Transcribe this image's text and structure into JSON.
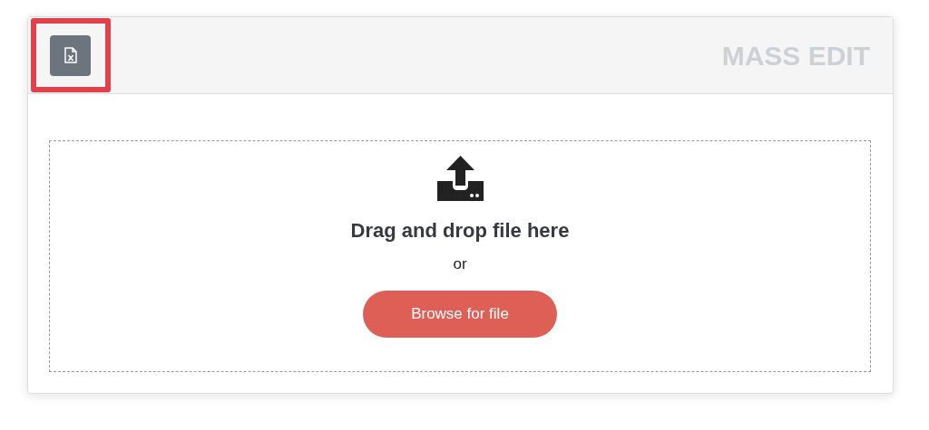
{
  "header": {
    "title": "MASS EDIT",
    "highlighted": true
  },
  "dropzone": {
    "heading": "Drag and drop file here",
    "separator": "or",
    "button": "Browse for file"
  }
}
